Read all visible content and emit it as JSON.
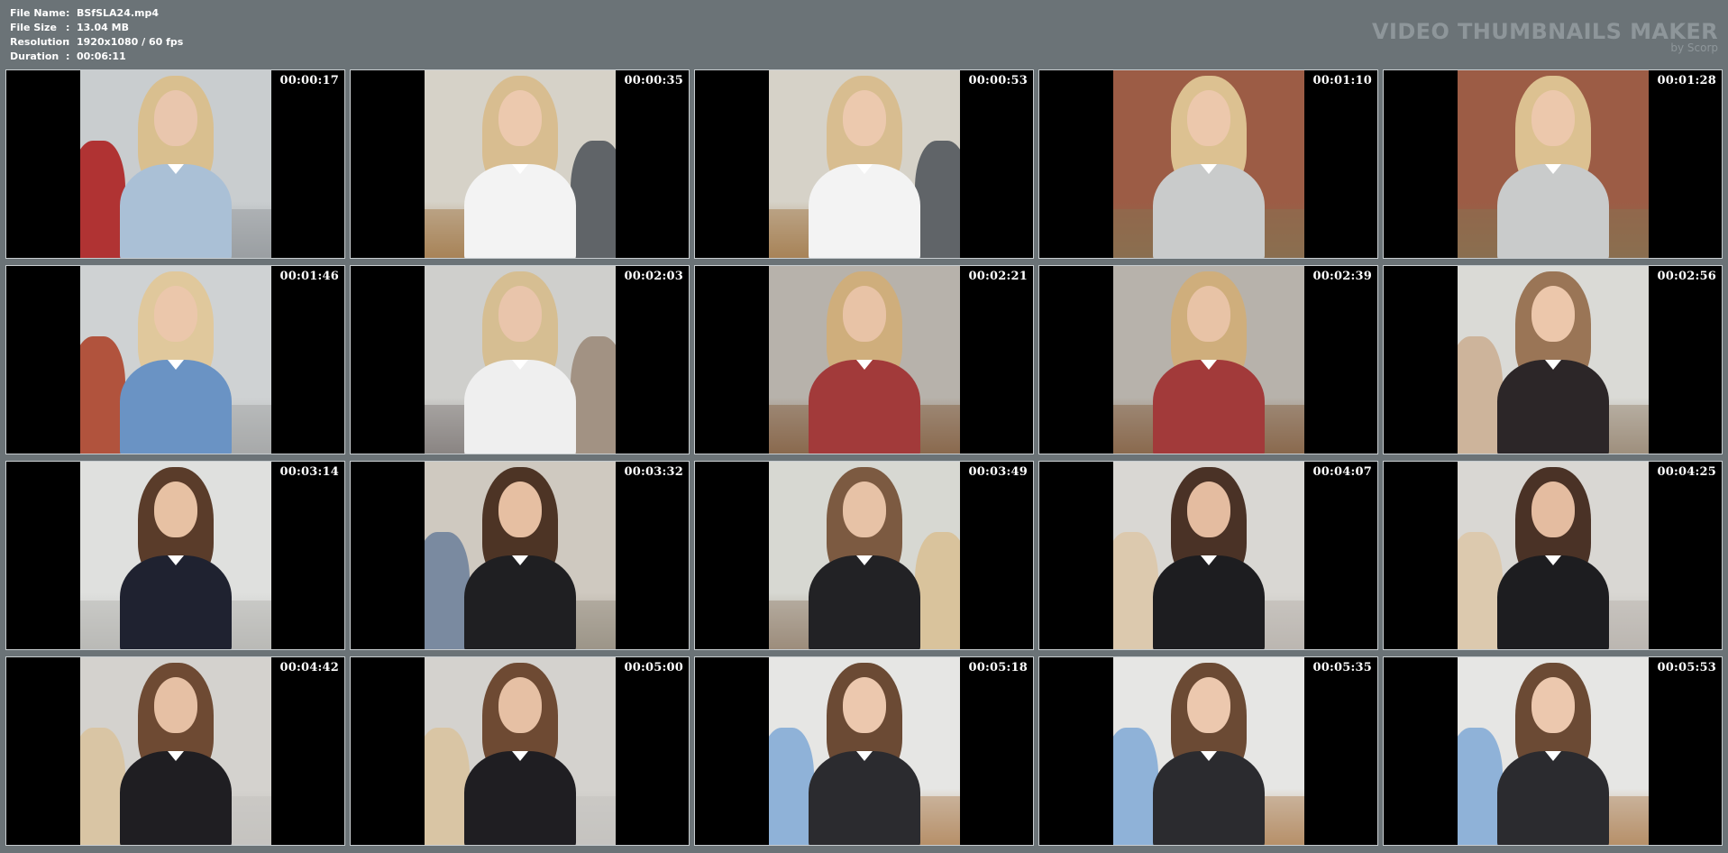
{
  "file_info": {
    "file_name": {
      "label": "File Name",
      "value": "BSfSLA24.mp4"
    },
    "file_size": {
      "label": "File Size",
      "value": "13.04 MB"
    },
    "resolution": {
      "label": "Resolution",
      "value": "1920x1080 / 60 fps"
    },
    "duration": {
      "label": "Duration",
      "value": "00:06:11"
    },
    "separator": ":"
  },
  "brand": {
    "title": "VIDEO THUMBNAILS MAKER",
    "subtitle": "by Scorp"
  },
  "thumbnails": [
    {
      "time": "00:00:17",
      "bg": "#c9cdcf",
      "floor": "#9a9fa2",
      "hair": "#d9bf8f",
      "skin": "#e9c6ad",
      "top": "#aac0d6",
      "side": "#b03333",
      "side_pos": "left"
    },
    {
      "time": "00:00:35",
      "bg": "#d6d2c8",
      "floor": "#a88358",
      "hair": "#d8bd90",
      "skin": "#ecc9ae",
      "top": "#f3f3f3",
      "side": "#606468",
      "side_pos": "right"
    },
    {
      "time": "00:00:53",
      "bg": "#d6d2c8",
      "floor": "#a88358",
      "hair": "#d8bd90",
      "skin": "#ecc9ae",
      "top": "#f3f3f3",
      "side": "#606468",
      "side_pos": "right"
    },
    {
      "time": "00:01:10",
      "bg": "#9c5c45",
      "floor": "#8a6f50",
      "hair": "#dcc191",
      "skin": "#ecc8ac",
      "top": "#c9cbcb",
      "side": "#6a91bd",
      "side_pos": "none"
    },
    {
      "time": "00:01:28",
      "bg": "#9c5c45",
      "floor": "#8a6f50",
      "hair": "#dcc191",
      "skin": "#ecc8ac",
      "top": "#c9cbcb",
      "side": "#6a91bd",
      "side_pos": "none"
    },
    {
      "time": "00:01:46",
      "bg": "#cfd2d3",
      "floor": "#a7a9aa",
      "hair": "#e0c89c",
      "skin": "#ebc7ab",
      "top": "#6a93c4",
      "side": "#b1533d",
      "side_pos": "left"
    },
    {
      "time": "00:02:03",
      "bg": "#cfcfcc",
      "floor": "#8a8583",
      "hair": "#d6be92",
      "skin": "#e9c5ab",
      "top": "#efefef",
      "side": "#a29283",
      "side_pos": "right"
    },
    {
      "time": "00:02:21",
      "bg": "#b7b2ab",
      "floor": "#8a6a4e",
      "hair": "#cfae7c",
      "skin": "#e8c3a6",
      "top": "#a23a3a",
      "side": "#2b3a5e",
      "side_pos": "none"
    },
    {
      "time": "00:02:39",
      "bg": "#b7b2ab",
      "floor": "#8a6a4e",
      "hair": "#cfae7c",
      "skin": "#e8c3a6",
      "top": "#a23a3a",
      "side": "#2b3a5e",
      "side_pos": "none"
    },
    {
      "time": "00:02:56",
      "bg": "#dadad6",
      "floor": "#9f8f7d",
      "hair": "#9a7556",
      "skin": "#ecc7ab",
      "top": "#2c2628",
      "side": "#cdb49b",
      "side_pos": "left"
    },
    {
      "time": "00:03:14",
      "bg": "#dfe0de",
      "floor": "#b9b9b6",
      "hair": "#5a3c2a",
      "skin": "#e7c1a3",
      "top": "#1f2230",
      "side": "#6e8c52",
      "side_pos": "none"
    },
    {
      "time": "00:03:32",
      "bg": "#cfc9c0",
      "floor": "#9c9588",
      "hair": "#4d3425",
      "skin": "#e6bfa2",
      "top": "#1f1f22",
      "side": "#7a8aa0",
      "side_pos": "left"
    },
    {
      "time": "00:03:49",
      "bg": "#d7d8d2",
      "floor": "#9c8d7b",
      "hair": "#7c5a41",
      "skin": "#e7c2a6",
      "top": "#222225",
      "side": "#d9c39c",
      "side_pos": "right"
    },
    {
      "time": "00:04:07",
      "bg": "#d9d7d3",
      "floor": "#bbb7b1",
      "hair": "#4a3226",
      "skin": "#e4bca0",
      "top": "#1d1d20",
      "side": "#dcc9ae",
      "side_pos": "left"
    },
    {
      "time": "00:04:25",
      "bg": "#d9d7d3",
      "floor": "#bbb7b1",
      "hair": "#4a3226",
      "skin": "#e4bca0",
      "top": "#1d1d20",
      "side": "#dcc9ae",
      "side_pos": "left"
    },
    {
      "time": "00:04:42",
      "bg": "#d4d2ce",
      "floor": "#c5c3c0",
      "hair": "#6e4a33",
      "skin": "#e6c0a4",
      "top": "#1f1e22",
      "side": "#d9c5a4",
      "side_pos": "left"
    },
    {
      "time": "00:05:00",
      "bg": "#d4d2ce",
      "floor": "#c5c3c0",
      "hair": "#6e4a33",
      "skin": "#e6c0a4",
      "top": "#1f1e22",
      "side": "#d9c5a4",
      "side_pos": "left"
    },
    {
      "time": "00:05:18",
      "bg": "#e6e6e4",
      "floor": "#b79069",
      "hair": "#6b4a34",
      "skin": "#ecc8ae",
      "top": "#2b2b2f",
      "side": "#8fb2d8",
      "side_pos": "left"
    },
    {
      "time": "00:05:35",
      "bg": "#e6e6e4",
      "floor": "#b79069",
      "hair": "#6b4a34",
      "skin": "#ecc8ae",
      "top": "#2b2b2f",
      "side": "#8fb2d8",
      "side_pos": "left"
    },
    {
      "time": "00:05:53",
      "bg": "#e6e6e4",
      "floor": "#b79069",
      "hair": "#6b4a34",
      "skin": "#ecc8ae",
      "top": "#2b2b2f",
      "side": "#8fb2d8",
      "side_pos": "left"
    }
  ]
}
